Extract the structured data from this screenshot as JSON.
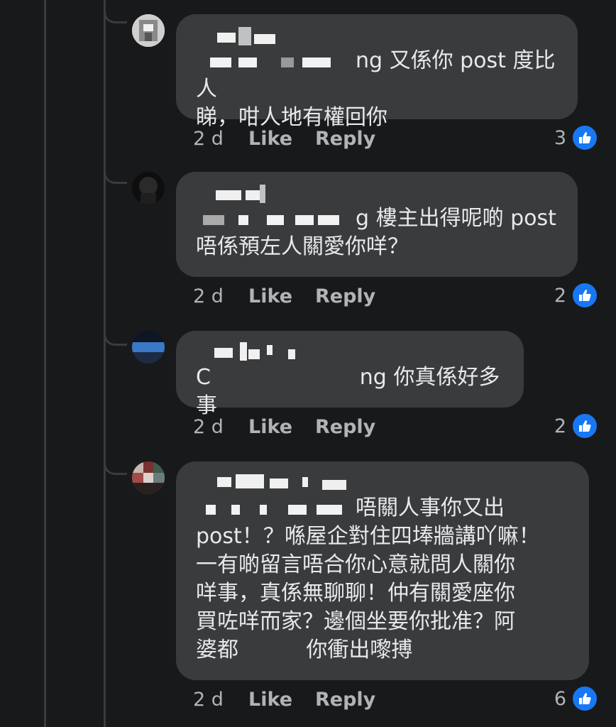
{
  "comments": [
    {
      "text_lines": [
        "ng 又係你 post 度比人",
        "睇，咁人地有權回你"
      ],
      "time": "2 d",
      "like_label": "Like",
      "reply_label": "Reply",
      "reaction_count": "3"
    },
    {
      "text_lines": [
        "g 樓主出得呢啲 post",
        "唔係預左人關愛你咩？"
      ],
      "time": "2 d",
      "like_label": "Like",
      "reply_label": "Reply",
      "reaction_count": "2"
    },
    {
      "text_lines": [
        "C                      ng 你真係好多事"
      ],
      "time": "2 d",
      "like_label": "Like",
      "reply_label": "Reply",
      "reaction_count": "2"
    },
    {
      "text_lines": [
        "唔關人事你又出",
        "post！？喺屋企對住四埲牆講吖嘛！",
        "一有啲留言唔合你心意就問人關你",
        "咩事，真係無聊聊！仲有關愛座你",
        "買咗咩而家？邊個坐要你批准？阿",
        "婆都          你衝出嚟搏"
      ],
      "time": "2 d",
      "like_label": "Like",
      "reply_label": "Reply",
      "reaction_count": "6"
    }
  ],
  "colors": {
    "background": "#18191a",
    "bubble": "#3a3b3c",
    "like_blue": "#1877f2",
    "meta_text": "#b0b3b8"
  },
  "icons": {
    "reaction": "thumbs-up-icon"
  }
}
